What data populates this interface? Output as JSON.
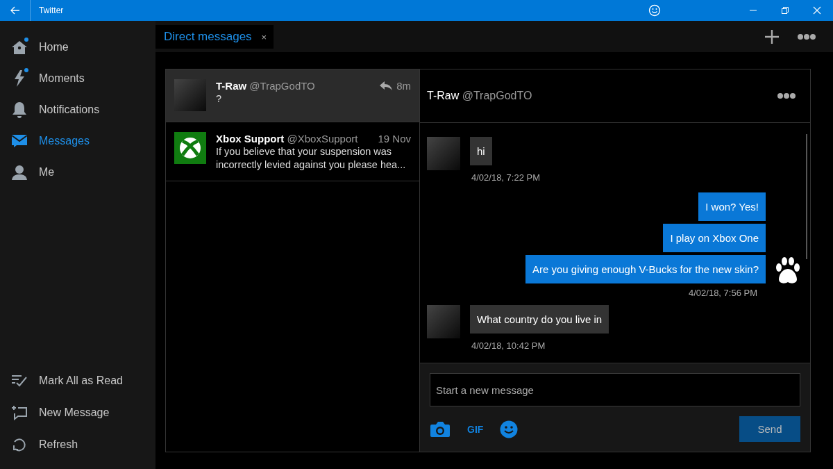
{
  "window": {
    "title": "Twitter"
  },
  "sidebar": {
    "items": [
      {
        "label": "Home",
        "unread": true,
        "selected": false
      },
      {
        "label": "Moments",
        "unread": true,
        "selected": false
      },
      {
        "label": "Notifications",
        "unread": false,
        "selected": false
      },
      {
        "label": "Messages",
        "unread": false,
        "selected": true
      },
      {
        "label": "Me",
        "unread": false,
        "selected": false
      }
    ],
    "actions": [
      {
        "label": "Mark All as Read"
      },
      {
        "label": "New Message"
      },
      {
        "label": "Refresh"
      }
    ]
  },
  "tab": {
    "label": "Direct messages",
    "close": "×"
  },
  "conversations": [
    {
      "name": "T-Raw",
      "handle": "@TrapGodTO",
      "time": "8m",
      "preview": "?",
      "replied": true,
      "selected": true
    },
    {
      "name": "Xbox Support",
      "handle": "@XboxSupport",
      "time": "19 Nov",
      "preview": "If you believe that your suspension was incorrectly levied against you please hea...",
      "replied": false,
      "selected": false
    }
  ],
  "chat": {
    "name": "T-Raw",
    "handle": "@TrapGodTO",
    "messages": [
      {
        "kind": "received",
        "text": "hi",
        "time": "4/02/18, 7:22 PM"
      },
      {
        "kind": "sent",
        "text": "I won? Yes!"
      },
      {
        "kind": "sent",
        "text": "I play on Xbox One"
      },
      {
        "kind": "sent",
        "text": "Are you giving enough V-Bucks for the new skin?",
        "time": "4/02/18, 7:56 PM"
      },
      {
        "kind": "received",
        "text": "What country do you live in",
        "time": "4/02/18, 10:42 PM"
      }
    ],
    "composer": {
      "placeholder": "Start a new message",
      "gif": "GIF",
      "send": "Send"
    }
  }
}
